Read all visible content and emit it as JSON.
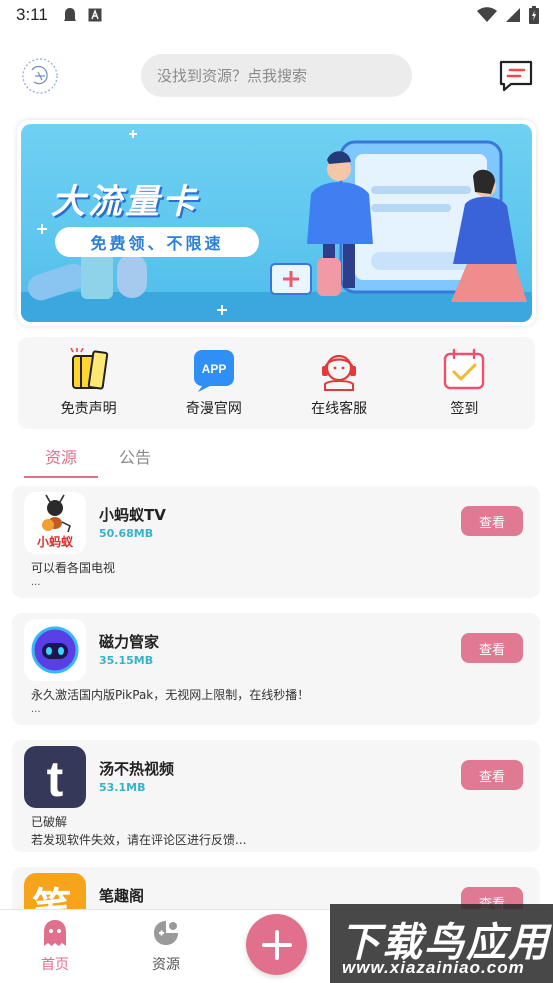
{
  "status_bar": {
    "time": "3:11"
  },
  "header": {
    "search_placeholder": "没找到资源？点我搜索"
  },
  "banner": {
    "title": "大流量卡",
    "subtitle": "免费领、不限速"
  },
  "quick_actions": [
    {
      "label": "免责声明",
      "icon": "book-icon"
    },
    {
      "label": "奇漫官网",
      "icon": "app-icon"
    },
    {
      "label": "在线客服",
      "icon": "customer-service-icon"
    },
    {
      "label": "签到",
      "icon": "calendar-check-icon"
    }
  ],
  "tabs": [
    {
      "label": "资源",
      "active": true
    },
    {
      "label": "公告",
      "active": false
    }
  ],
  "view_label": "查看",
  "apps": [
    {
      "name": "小蚂蚁TV",
      "size": "50.68MB",
      "desc": "可以看各国电视",
      "desc2": "",
      "icon_text": "小蚂蚁"
    },
    {
      "name": "磁力管家",
      "size": "35.15MB",
      "desc": "永久激活国内版PikPak，无视网上限制，在线秒播！",
      "desc2": ""
    },
    {
      "name": "汤不热视频",
      "size": "53.1MB",
      "desc": "已破解",
      "desc2": "若发现软件失效，请在评论区进行反馈..."
    },
    {
      "name": "笔趣阁",
      "size": "",
      "desc": "",
      "desc2": "",
      "icon_text": "笔"
    }
  ],
  "ellipsis": "...",
  "bottom_nav": [
    {
      "label": "首页",
      "active": true
    },
    {
      "label": "资源",
      "active": false
    }
  ],
  "app_icon_text": "APP",
  "tumblr_letter": "t",
  "watermark": {
    "title": "下载鸟应用",
    "url": "www.xiazainiao.com"
  },
  "colors": {
    "accent": "#e0708b",
    "size_text": "#35b3c9",
    "card_bg": "#f6f6f6"
  }
}
